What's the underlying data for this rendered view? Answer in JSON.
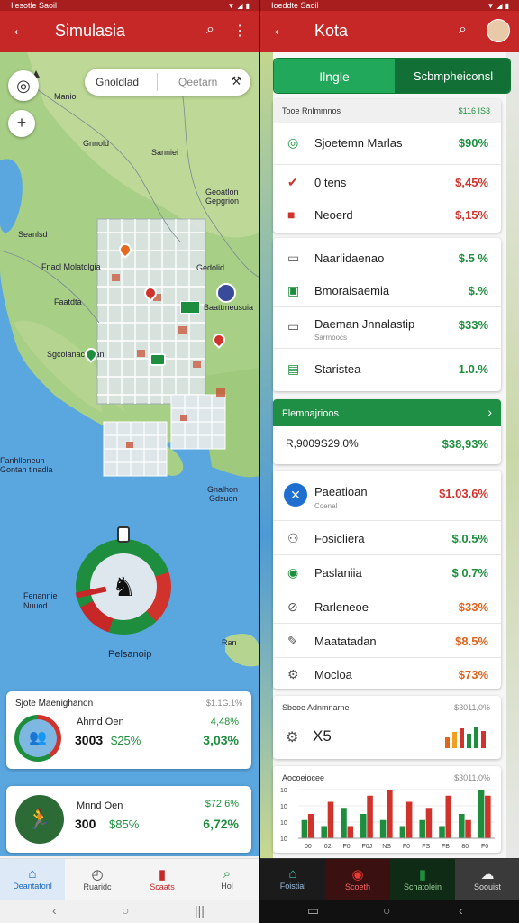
{
  "left": {
    "status_text": "Iiesotle Saoil",
    "appbar": {
      "title": "Simulasia"
    },
    "search": {
      "left_label": "Gnoldlad",
      "right_label": "Qeetarn"
    },
    "map_labels": [
      "Manio",
      "Gnnold",
      "Sanniei",
      "Geoatlon",
      "Gepgrion",
      "Seanlsd",
      "Fnacl Molatolgia",
      "Gedolid",
      "Faatdta",
      "Baattmeusuia",
      "Sgcolanacs tlan",
      "Fanhlloneun",
      "Gontan tinadla",
      "Gnalhon",
      "Gdsuon",
      "Fenannie Nuuod",
      "Pelsanoip",
      "Ran"
    ],
    "card1": {
      "title": "Sjote Maenighanon",
      "top_value": "$1.1G.1%",
      "name": "Ahmd Oen",
      "code": "3003",
      "pct": "$25%",
      "right_top": "4,48%",
      "right_bottom": "3,03%"
    },
    "card2": {
      "name": "Mnnd Oen",
      "code": "300",
      "pct": "$85%",
      "right_top": "$72.6%",
      "right_bottom": "6,72%"
    },
    "nav": [
      "Deantatonl",
      "Ruaridc",
      "Scaats",
      "Hol"
    ],
    "colors": {
      "primary": "#c62828",
      "accent": "#1e8e3e"
    }
  },
  "right": {
    "status_text": "Ioeddte Saoil",
    "appbar": {
      "title": "Kota"
    },
    "tabs": {
      "first": "Ilngle",
      "second": "Scbmpheiconsl"
    },
    "group1": {
      "header": "Tooe Rnlmmnos",
      "header_value": "$116 IS3",
      "rows": [
        {
          "label": "Sjoetemn Marlas",
          "value": "$90%"
        },
        {
          "label": "0 tens",
          "value": "$,45%"
        },
        {
          "label": "Neoerd",
          "value": "$,15%"
        }
      ]
    },
    "group2": {
      "rows": [
        {
          "label": "Naarlidaenao",
          "value": "$.5 %"
        },
        {
          "label": "Bmoraisaemia",
          "value": "$.%"
        },
        {
          "label": "Daeman Jnnalastip",
          "sub": "Sarmoocs",
          "value": "$33%"
        },
        {
          "label": "Staristea",
          "value": "1.0.%"
        }
      ]
    },
    "banner": {
      "title": "Flemnajrioos",
      "arrow": "›",
      "metric": "R,9009S29.0%",
      "value": "$38,93%"
    },
    "group3": {
      "rows": [
        {
          "label": "Paeatioan",
          "sub": "Coenal",
          "value": "$1.03.6%"
        },
        {
          "label": "Fosicliera",
          "value": "$.0.5%"
        },
        {
          "label": "Paslaniia",
          "value": "$ 0.7%"
        },
        {
          "label": "Rarleneoe",
          "value": "$33%"
        },
        {
          "label": "Maatatadan",
          "value": "$8.5%"
        },
        {
          "label": "Mocloa",
          "value": "$73%"
        }
      ]
    },
    "card_a": {
      "title": "Sbeoe Adnmnarne",
      "value": "$3011,0%",
      "number": "X5"
    },
    "chart_card": {
      "title": "Aocoeiocee",
      "value": "$3011,0%"
    },
    "chart_data": {
      "type": "bar",
      "title": "Aocoeiocee",
      "ytick_labels": [
        "10",
        "10",
        "10",
        "10"
      ],
      "xtick_labels": [
        "00",
        "02",
        "F0I",
        "F0J",
        "NS",
        "F0",
        "FS",
        "FB",
        "80",
        "F0"
      ],
      "series": [
        {
          "color": "#1e8e3e",
          "values": [
            3,
            2,
            5,
            4,
            3,
            2,
            3,
            2,
            4,
            8
          ]
        },
        {
          "color": "#d0332b",
          "values": [
            4,
            6,
            2,
            7,
            8,
            6,
            5,
            7,
            3,
            7
          ]
        }
      ]
    },
    "nav": [
      "Foistial",
      "Scoeth",
      "Schatolein",
      "Soouist"
    ],
    "colors": {
      "primary": "#c62828",
      "accent": "#1e8e3e"
    }
  }
}
